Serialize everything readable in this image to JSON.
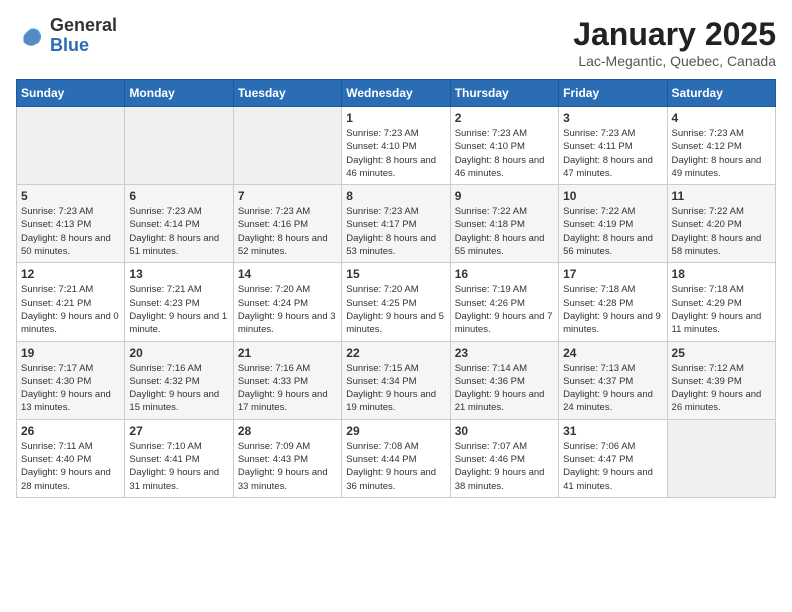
{
  "logo": {
    "general": "General",
    "blue": "Blue"
  },
  "title": "January 2025",
  "location": "Lac-Megantic, Quebec, Canada",
  "days_of_week": [
    "Sunday",
    "Monday",
    "Tuesday",
    "Wednesday",
    "Thursday",
    "Friday",
    "Saturday"
  ],
  "weeks": [
    [
      {
        "day": "",
        "info": ""
      },
      {
        "day": "",
        "info": ""
      },
      {
        "day": "",
        "info": ""
      },
      {
        "day": "1",
        "info": "Sunrise: 7:23 AM\nSunset: 4:10 PM\nDaylight: 8 hours and 46 minutes."
      },
      {
        "day": "2",
        "info": "Sunrise: 7:23 AM\nSunset: 4:10 PM\nDaylight: 8 hours and 46 minutes."
      },
      {
        "day": "3",
        "info": "Sunrise: 7:23 AM\nSunset: 4:11 PM\nDaylight: 8 hours and 47 minutes."
      },
      {
        "day": "4",
        "info": "Sunrise: 7:23 AM\nSunset: 4:12 PM\nDaylight: 8 hours and 49 minutes."
      }
    ],
    [
      {
        "day": "5",
        "info": "Sunrise: 7:23 AM\nSunset: 4:13 PM\nDaylight: 8 hours and 50 minutes."
      },
      {
        "day": "6",
        "info": "Sunrise: 7:23 AM\nSunset: 4:14 PM\nDaylight: 8 hours and 51 minutes."
      },
      {
        "day": "7",
        "info": "Sunrise: 7:23 AM\nSunset: 4:16 PM\nDaylight: 8 hours and 52 minutes."
      },
      {
        "day": "8",
        "info": "Sunrise: 7:23 AM\nSunset: 4:17 PM\nDaylight: 8 hours and 53 minutes."
      },
      {
        "day": "9",
        "info": "Sunrise: 7:22 AM\nSunset: 4:18 PM\nDaylight: 8 hours and 55 minutes."
      },
      {
        "day": "10",
        "info": "Sunrise: 7:22 AM\nSunset: 4:19 PM\nDaylight: 8 hours and 56 minutes."
      },
      {
        "day": "11",
        "info": "Sunrise: 7:22 AM\nSunset: 4:20 PM\nDaylight: 8 hours and 58 minutes."
      }
    ],
    [
      {
        "day": "12",
        "info": "Sunrise: 7:21 AM\nSunset: 4:21 PM\nDaylight: 9 hours and 0 minutes."
      },
      {
        "day": "13",
        "info": "Sunrise: 7:21 AM\nSunset: 4:23 PM\nDaylight: 9 hours and 1 minute."
      },
      {
        "day": "14",
        "info": "Sunrise: 7:20 AM\nSunset: 4:24 PM\nDaylight: 9 hours and 3 minutes."
      },
      {
        "day": "15",
        "info": "Sunrise: 7:20 AM\nSunset: 4:25 PM\nDaylight: 9 hours and 5 minutes."
      },
      {
        "day": "16",
        "info": "Sunrise: 7:19 AM\nSunset: 4:26 PM\nDaylight: 9 hours and 7 minutes."
      },
      {
        "day": "17",
        "info": "Sunrise: 7:18 AM\nSunset: 4:28 PM\nDaylight: 9 hours and 9 minutes."
      },
      {
        "day": "18",
        "info": "Sunrise: 7:18 AM\nSunset: 4:29 PM\nDaylight: 9 hours and 11 minutes."
      }
    ],
    [
      {
        "day": "19",
        "info": "Sunrise: 7:17 AM\nSunset: 4:30 PM\nDaylight: 9 hours and 13 minutes."
      },
      {
        "day": "20",
        "info": "Sunrise: 7:16 AM\nSunset: 4:32 PM\nDaylight: 9 hours and 15 minutes."
      },
      {
        "day": "21",
        "info": "Sunrise: 7:16 AM\nSunset: 4:33 PM\nDaylight: 9 hours and 17 minutes."
      },
      {
        "day": "22",
        "info": "Sunrise: 7:15 AM\nSunset: 4:34 PM\nDaylight: 9 hours and 19 minutes."
      },
      {
        "day": "23",
        "info": "Sunrise: 7:14 AM\nSunset: 4:36 PM\nDaylight: 9 hours and 21 minutes."
      },
      {
        "day": "24",
        "info": "Sunrise: 7:13 AM\nSunset: 4:37 PM\nDaylight: 9 hours and 24 minutes."
      },
      {
        "day": "25",
        "info": "Sunrise: 7:12 AM\nSunset: 4:39 PM\nDaylight: 9 hours and 26 minutes."
      }
    ],
    [
      {
        "day": "26",
        "info": "Sunrise: 7:11 AM\nSunset: 4:40 PM\nDaylight: 9 hours and 28 minutes."
      },
      {
        "day": "27",
        "info": "Sunrise: 7:10 AM\nSunset: 4:41 PM\nDaylight: 9 hours and 31 minutes."
      },
      {
        "day": "28",
        "info": "Sunrise: 7:09 AM\nSunset: 4:43 PM\nDaylight: 9 hours and 33 minutes."
      },
      {
        "day": "29",
        "info": "Sunrise: 7:08 AM\nSunset: 4:44 PM\nDaylight: 9 hours and 36 minutes."
      },
      {
        "day": "30",
        "info": "Sunrise: 7:07 AM\nSunset: 4:46 PM\nDaylight: 9 hours and 38 minutes."
      },
      {
        "day": "31",
        "info": "Sunrise: 7:06 AM\nSunset: 4:47 PM\nDaylight: 9 hours and 41 minutes."
      },
      {
        "day": "",
        "info": ""
      }
    ]
  ]
}
